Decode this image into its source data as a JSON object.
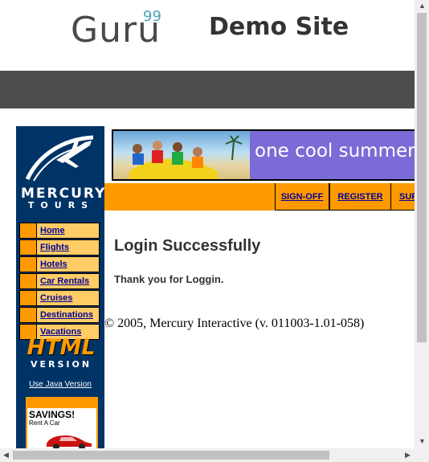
{
  "header": {
    "logo_text": "Guru",
    "logo_sup": "99",
    "title": "Demo Site"
  },
  "mercury": {
    "brand_line1": "MERCURY",
    "brand_line2": "TOURS",
    "banner_text": "one cool summer",
    "nav": [
      {
        "label": "SIGN-OFF"
      },
      {
        "label": "REGISTER"
      },
      {
        "label": "SUPPORT"
      }
    ],
    "menu": [
      {
        "label": "Home"
      },
      {
        "label": "Flights"
      },
      {
        "label": "Hotels"
      },
      {
        "label": "Car Rentals"
      },
      {
        "label": "Cruises"
      },
      {
        "label": "Destinations"
      },
      {
        "label": "Vacations"
      }
    ],
    "html_version": {
      "word1": "HTML",
      "word2": "VERSION",
      "link": "Use Java Version"
    },
    "savings": {
      "title": "SAVINGS!",
      "subtitle": "Rent A Car"
    }
  },
  "content": {
    "title": "Login Successfully",
    "message": "Thank you for Loggin.",
    "copyright": "© 2005, Mercury Interactive (v. 011003-1.01-058)"
  },
  "colors": {
    "brand_blue": "#003366",
    "accent_orange": "#ff9900",
    "menu_bg": "#ffcc66",
    "header_bar": "#4d4d4d"
  }
}
